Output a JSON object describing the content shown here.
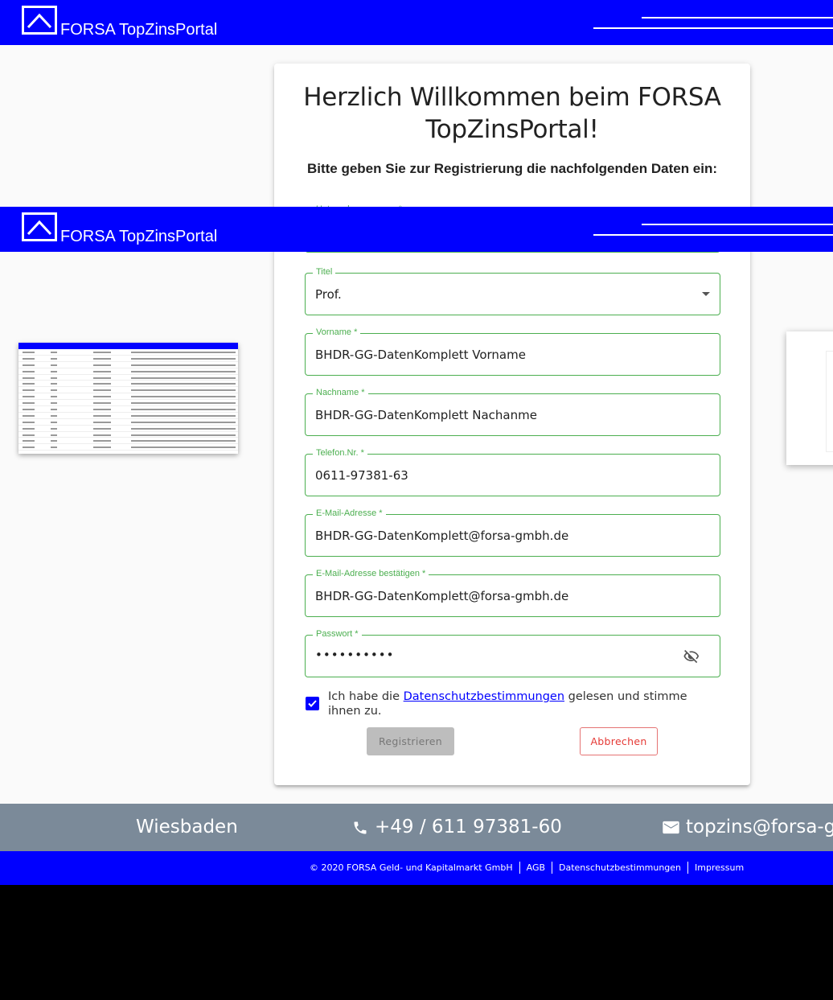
{
  "header": {
    "brand": "FORSA TopZinsPortal"
  },
  "card": {
    "title": "Herzlich Willkommen beim FORSA TopZinsPortal!",
    "subtitle": "Bitte geben Sie zur Registrierung die nachfolgenden Daten ein:"
  },
  "form": {
    "company": {
      "label": "Unternehmensname *",
      "value": ""
    },
    "title": {
      "label": "Titel",
      "value": "Prof."
    },
    "firstname": {
      "label": "Vorname *",
      "value": "BHDR-GG-DatenKomplett Vorname"
    },
    "lastname": {
      "label": "Nachname *",
      "value": "BHDR-GG-DatenKomplett Nachanme"
    },
    "phone": {
      "label": "Telefon.Nr. *",
      "value": "0611-97381-63"
    },
    "email": {
      "label": "E-Mail-Adresse *",
      "value": "BHDR-GG-DatenKomplett@forsa-gmbh.de"
    },
    "email_confirm": {
      "label": "E-Mail-Adresse bestätigen *",
      "value": "BHDR-GG-DatenKomplett@forsa-gmbh.de"
    },
    "password": {
      "label": "Passwort *",
      "value": "••••••••••"
    },
    "consent": {
      "prefix": "Ich habe die ",
      "link": "Datenschutzbestimmungen",
      "suffix": " gelesen und stimme ihnen zu.",
      "checked": true
    },
    "register_label": "Registrieren",
    "cancel_label": "Abbrechen"
  },
  "footer": {
    "city": "Wiesbaden",
    "phone": "+49 / 611 97381-60",
    "email": "topzins@forsa-gm",
    "copyright": "© 2020 FORSA Geld- und Kapitalmarkt GmbH",
    "agb": "AGB",
    "privacy": "Datenschutzbestimmungen",
    "imprint": "Impressum"
  },
  "colors": {
    "brand_blue": "#0000ff",
    "field_green": "#4caf50",
    "cancel_red": "#e53935",
    "footer_gray": "#7b8a99"
  }
}
